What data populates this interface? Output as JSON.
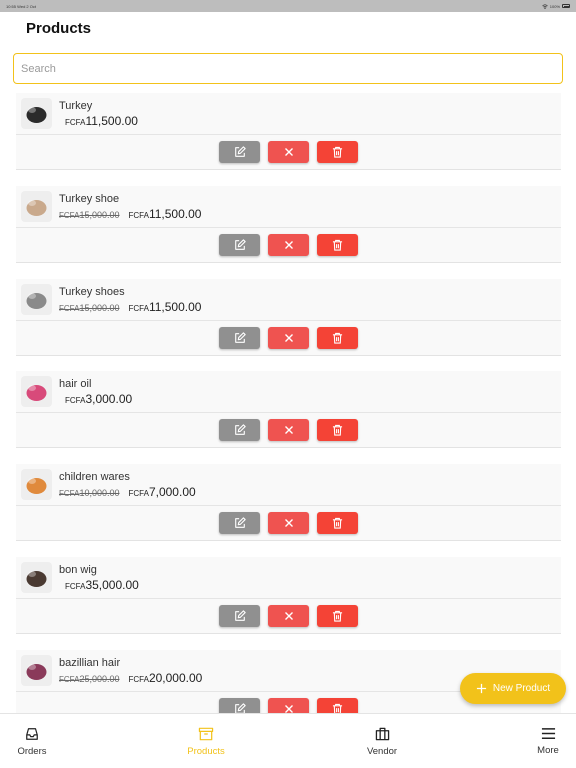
{
  "status_bar": {
    "time": "10:55",
    "date": "Wed 2 Oct",
    "battery": "100%"
  },
  "page": {
    "title": "Products"
  },
  "search": {
    "placeholder": "Search",
    "value": ""
  },
  "products": [
    {
      "name": "Turkey",
      "currency": "FCFA",
      "price": "11,500.00",
      "old_price": null,
      "thumb_icon": "shoe-photo",
      "thumb_color": "#2b2b2b"
    },
    {
      "name": "Turkey shoe",
      "currency": "FCFA",
      "price": "11,500.00",
      "old_price": "15,000.00",
      "thumb_icon": "shoe-photo",
      "thumb_color": "#c9a98c"
    },
    {
      "name": "Turkey shoes",
      "currency": "FCFA",
      "price": "11,500.00",
      "old_price": "15,000.00",
      "thumb_icon": "shoe-photo",
      "thumb_color": "#8a8a8a"
    },
    {
      "name": "hair oil",
      "currency": "FCFA",
      "price": "3,000.00",
      "old_price": null,
      "thumb_icon": "bottle-photo",
      "thumb_color": "#d84a7a"
    },
    {
      "name": "children wares",
      "currency": "FCFA",
      "price": "7,000.00",
      "old_price": "10,000.00",
      "thumb_icon": "clothes-photo",
      "thumb_color": "#e08a3c"
    },
    {
      "name": "bon wig",
      "currency": "FCFA",
      "price": "35,000.00",
      "old_price": null,
      "thumb_icon": "wig-photo",
      "thumb_color": "#4a3a32"
    },
    {
      "name": "bazillian hair",
      "currency": "FCFA",
      "price": "20,000.00",
      "old_price": "25,000.00",
      "thumb_icon": "hair-photo",
      "thumb_color": "#8a3a5a"
    }
  ],
  "product_actions": {
    "edit_icon": "edit-icon",
    "remove_icon": "close-icon",
    "delete_icon": "trash-icon"
  },
  "fab": {
    "label": "New Product",
    "icon": "plus-icon"
  },
  "tabs": [
    {
      "label": "Orders",
      "icon": "inbox-icon",
      "active": false
    },
    {
      "label": "Products",
      "icon": "archive-box-icon",
      "active": true
    },
    {
      "label": "Vendor",
      "icon": "briefcase-icon",
      "active": false
    },
    {
      "label": "More",
      "icon": "menu-icon",
      "active": false
    }
  ],
  "colors": {
    "accent": "#f2c21a",
    "edit": "#909090",
    "remove": "#ef5350",
    "delete": "#f44336"
  }
}
